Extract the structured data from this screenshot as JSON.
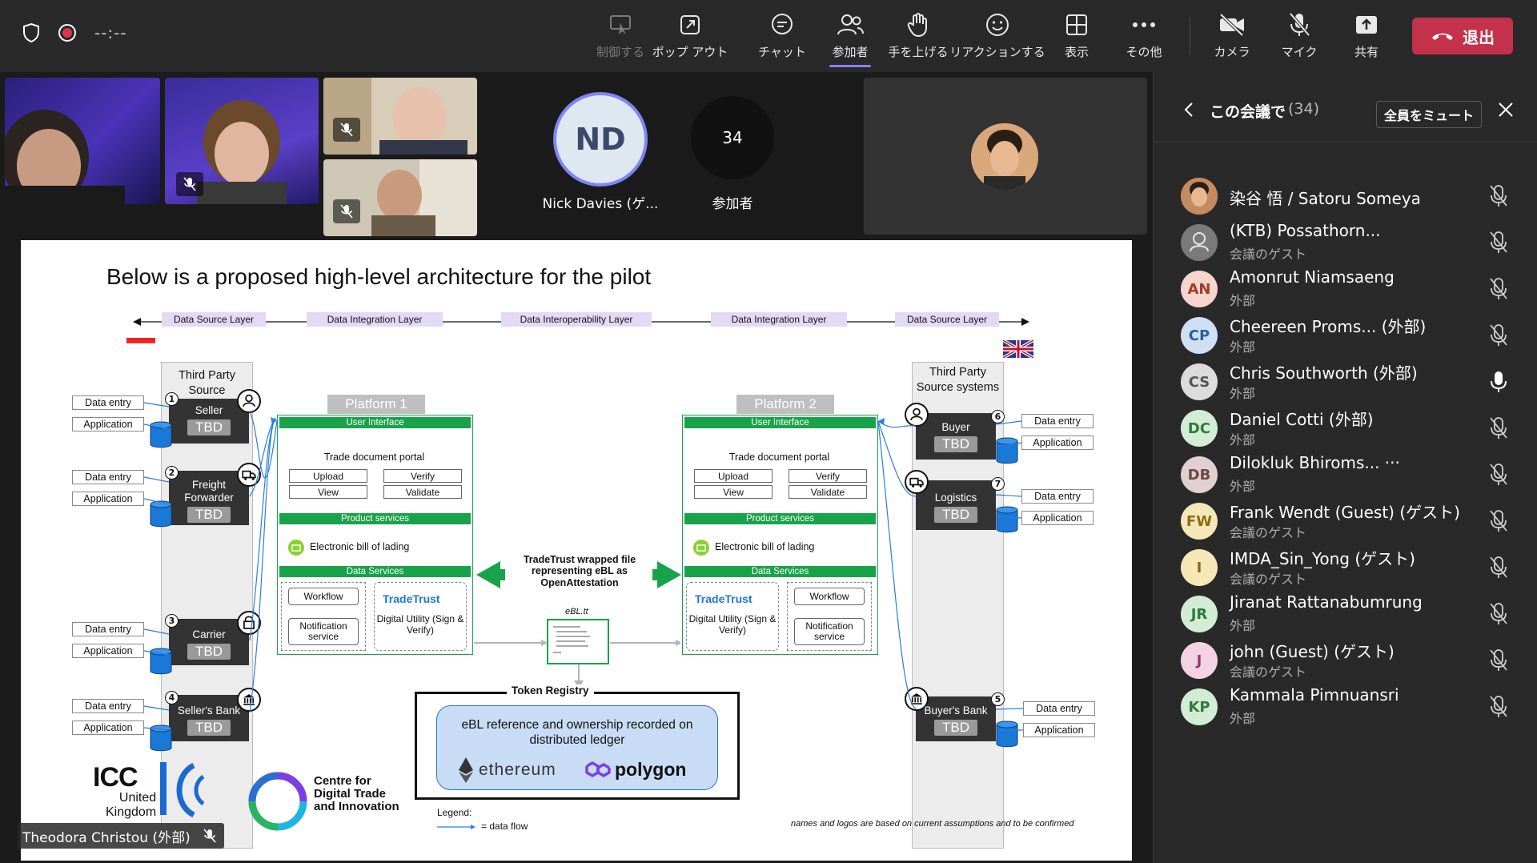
{
  "meeting": {
    "timer": "--:--"
  },
  "toolbar": {
    "control": "制御する",
    "popout": "ポップ アウト",
    "chat": "チャット",
    "participants": "参加者",
    "raise_hand": "手を上げる",
    "react": "リアクションする",
    "view": "表示",
    "more": "その他",
    "camera": "カメラ",
    "mic": "マイク",
    "share": "共有",
    "leave": "退出"
  },
  "stage": {
    "nd_initials": "ND",
    "nd_name": "Nick Davies (ゲ...",
    "overflow_count": "34",
    "overflow_label": "参加者",
    "presenter": "Theodora Christou (外部)"
  },
  "panel": {
    "title": "この会議で",
    "count": "(34)",
    "mute_all": "全員をミュート",
    "participants": [
      {
        "initials": "",
        "name": "染谷 悟 / Satoru Someya",
        "sub": "",
        "color": "#b07a50",
        "photo": true,
        "mic": "off"
      },
      {
        "initials": "",
        "name": "(KTB) Possathorn...",
        "sub": "会議のゲスト",
        "color": "#7a7a7a",
        "photo": false,
        "mic": "off"
      },
      {
        "initials": "AN",
        "name": "Amonrut Niamsaeng",
        "sub": "外部",
        "color": "#f6d5cf",
        "fg": "#a33a2a",
        "mic": "off"
      },
      {
        "initials": "CP",
        "name": "Cheereen Proms... (外部)",
        "sub": "外部",
        "color": "#cfe0f5",
        "fg": "#2b5f9e",
        "mic": "off"
      },
      {
        "initials": "CS",
        "name": "Chris Southworth (外部)",
        "sub": "外部",
        "color": "#dcdcdc",
        "fg": "#555",
        "mic": "on"
      },
      {
        "initials": "DC",
        "name": "Daniel Cotti (外部)",
        "sub": "外部",
        "color": "#d3ecd6",
        "fg": "#2f7a3b",
        "mic": "off"
      },
      {
        "initials": "DB",
        "name": "Dilokluk Bhiroms... ···",
        "sub": "外部",
        "color": "#e0d0cf",
        "fg": "#6b4a47",
        "mic": "off"
      },
      {
        "initials": "FW",
        "name": "Frank Wendt (Guest) (ゲスト)",
        "sub": "会議のゲスト",
        "color": "#f5e7b8",
        "fg": "#8a6d12",
        "mic": "off"
      },
      {
        "initials": "I",
        "name": "IMDA_Sin_Yong (ゲスト)",
        "sub": "会議のゲスト",
        "color": "#f5e7b8",
        "fg": "#8a6d12",
        "mic": "off"
      },
      {
        "initials": "JR",
        "name": "Jiranat Rattanabumrung",
        "sub": "外部",
        "color": "#d3ecd6",
        "fg": "#2f7a3b",
        "mic": "off"
      },
      {
        "initials": "J",
        "name": "john (Guest) (ゲスト)",
        "sub": "会議のゲスト",
        "color": "#f3d3e3",
        "fg": "#9b3566",
        "mic": "off"
      },
      {
        "initials": "KP",
        "name": "Kammala Pimnuansri",
        "sub": "外部",
        "color": "#d3ecd6",
        "fg": "#2f7a3b",
        "mic": "off"
      }
    ]
  },
  "slide": {
    "title": "Below is a proposed high-level architecture for the pilot",
    "layers": [
      "Data Source Layer",
      "Data Integration Layer",
      "Data Interoperability Layer",
      "Data Integration Layer",
      "Data Source Layer"
    ],
    "third_party_left": "Third Party Source",
    "third_party_right": "Third Party Source systems",
    "data_entry": "Data entry",
    "application": "Application",
    "tbd": "TBD",
    "left_actors": [
      {
        "num": "1",
        "name": "Seller"
      },
      {
        "num": "2",
        "name": "Freight Forwarder"
      },
      {
        "num": "3",
        "name": "Carrier"
      },
      {
        "num": "4",
        "name": "Seller's Bank"
      }
    ],
    "right_actors": [
      {
        "num": "6",
        "name": "Buyer"
      },
      {
        "num": "7",
        "name": "Logistics"
      },
      {
        "num": "5",
        "name": "Buyer's Bank"
      }
    ],
    "platform1": "Platform 1",
    "platform2": "Platform 2",
    "user_interface": "User Interface",
    "portal": "Trade document portal",
    "upload": "Upload",
    "verify": "Verify",
    "view": "View",
    "validate": "Validate",
    "product_services": "Product services",
    "ebl": "Electronic bill of lading",
    "data_services": "Data Services",
    "workflow": "Workflow",
    "notification": "Notification service",
    "tradetrust": "TradeTrust",
    "digital_utility": "Digital Utility (Sign & Verify)",
    "wrapped": "TradeTrust wrapped file representing eBL as OpenAttestation",
    "ebl_tt": "eBL.tt",
    "token_registry": "Token Registry",
    "ledger": "eBL reference and ownership recorded on distributed ledger",
    "ethereum": "ethereum",
    "polygon": "polygon",
    "icc": "ICC",
    "icc_sub1": "United",
    "icc_sub2": "Kingdom",
    "cdti": "Centre for Digital Trade and Innovation",
    "legend": "Legend:",
    "legend_item": "= data flow",
    "footnote": "names and logos are based on current assumptions and to be confirmed"
  }
}
